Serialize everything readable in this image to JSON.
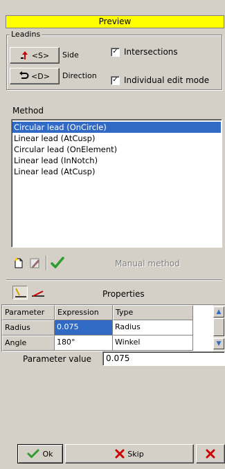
{
  "title": "Preview",
  "leadins": {
    "group_label": "Leadins",
    "side_button": "<S>",
    "side_label": "Side",
    "direction_button": "<D>",
    "direction_label": "Direction",
    "intersections_label": "Intersections",
    "intersections_checked": true,
    "individual_edit_label": "Individual edit mode",
    "individual_edit_checked": true
  },
  "method": {
    "group_label": "Method",
    "items": [
      {
        "label": "Circular lead (OnCircle)",
        "selected": true
      },
      {
        "label": "Linear lead (AtCusp)",
        "selected": false
      },
      {
        "label": "Circular lead (OnElement)",
        "selected": false
      },
      {
        "label": "Linear lead (InNotch)",
        "selected": false
      },
      {
        "label": "Linear lead (AtCusp)",
        "selected": false
      }
    ],
    "manual_method_label": "Manual method"
  },
  "properties": {
    "title": "Properties",
    "columns": [
      "Parameter",
      "Expression",
      "Type"
    ],
    "rows": [
      {
        "parameter": "Radius",
        "expression": "0.075",
        "type": "Radius"
      },
      {
        "parameter": "Angle",
        "expression": "180°",
        "type": "Winkel"
      }
    ],
    "parameter_value_label": "Parameter value",
    "parameter_value": "0.075"
  },
  "footer": {
    "ok_label": "Ok",
    "skip_label": "Skip"
  },
  "colors": {
    "title_bg": "#ffff00",
    "selection": "#316ac5",
    "check_green": "#2e9b2e",
    "cancel_red": "#cc0000"
  }
}
